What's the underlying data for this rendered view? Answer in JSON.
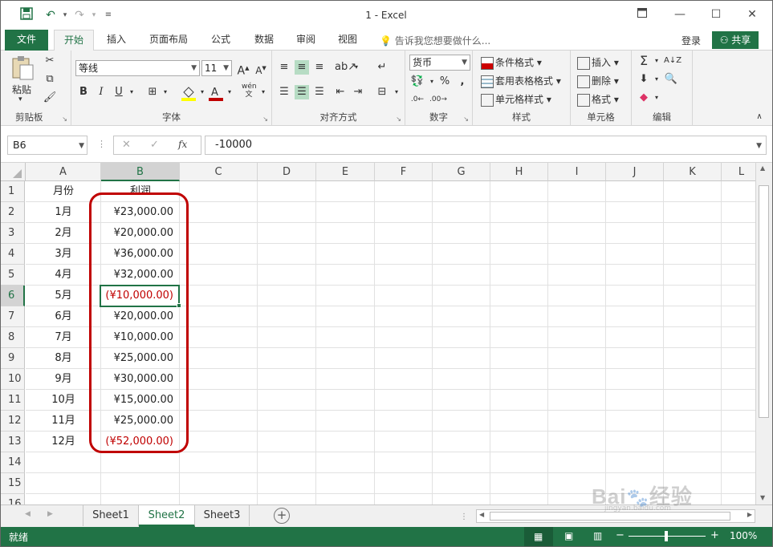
{
  "window": {
    "title": "1 - Excel"
  },
  "ribbon_tabs": [
    "文件",
    "开始",
    "插入",
    "页面布局",
    "公式",
    "数据",
    "审阅",
    "视图"
  ],
  "tell_me": "告诉我您想要做什么...",
  "account": {
    "login": "登录",
    "share": "共享"
  },
  "ribbon": {
    "clipboard": {
      "paste": "粘贴",
      "label": "剪贴板"
    },
    "font": {
      "name": "等线",
      "size": "11",
      "label": "字体",
      "wen": "wén"
    },
    "alignment": {
      "label": "对齐方式"
    },
    "number": {
      "format": "货币",
      "label": "数字"
    },
    "styles": {
      "conditional": "条件格式",
      "table": "套用表格格式",
      "cell": "单元格样式",
      "label": "样式"
    },
    "cells": {
      "insert": "插入",
      "delete": "删除",
      "format": "格式",
      "label": "单元格"
    },
    "editing": {
      "label": "编辑"
    }
  },
  "formula_bar": {
    "name_box": "B6",
    "formula": "-10000",
    "fx": "fx"
  },
  "columns": [
    "A",
    "B",
    "C",
    "D",
    "E",
    "F",
    "G",
    "H",
    "I",
    "J",
    "K",
    "L"
  ],
  "rows": [
    "1",
    "2",
    "3",
    "4",
    "5",
    "6",
    "7",
    "8",
    "9",
    "10",
    "11",
    "12",
    "13",
    "14",
    "15",
    "16"
  ],
  "table": {
    "header": {
      "month": "月份",
      "profit": "利润"
    },
    "data": [
      {
        "month": "1月",
        "profit": "¥23,000.00"
      },
      {
        "month": "2月",
        "profit": "¥20,000.00"
      },
      {
        "month": "3月",
        "profit": "¥36,000.00"
      },
      {
        "month": "4月",
        "profit": "¥32,000.00"
      },
      {
        "month": "5月",
        "profit": "(¥10,000.00)"
      },
      {
        "month": "6月",
        "profit": "¥20,000.00"
      },
      {
        "month": "7月",
        "profit": "¥10,000.00"
      },
      {
        "month": "8月",
        "profit": "¥25,000.00"
      },
      {
        "month": "9月",
        "profit": "¥30,000.00"
      },
      {
        "month": "10月",
        "profit": "¥15,000.00"
      },
      {
        "month": "11月",
        "profit": "¥25,000.00"
      },
      {
        "month": "12月",
        "profit": "(¥52,000.00)"
      }
    ]
  },
  "sheets": [
    "Sheet1",
    "Sheet2",
    "Sheet3"
  ],
  "active_sheet": "Sheet2",
  "status": {
    "ready": "就绪",
    "zoom": "100%",
    "zoom_level": 1.0
  },
  "watermark": "Baidu 经验 jingyan.baidu.com",
  "colors": {
    "accent": "#217346",
    "negative": "#c00000",
    "highlight_circle": "#c00000"
  }
}
